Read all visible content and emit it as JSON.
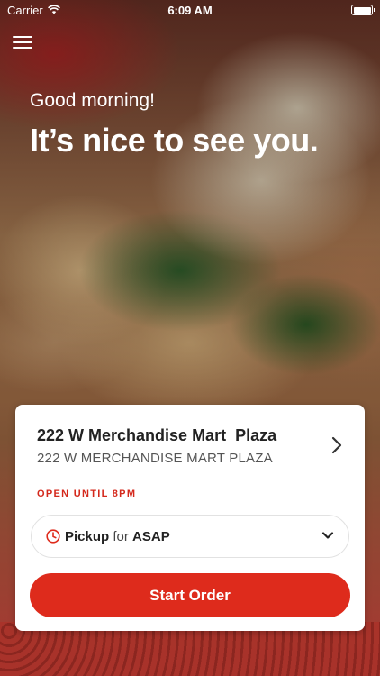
{
  "status_bar": {
    "carrier": "Carrier",
    "time": "6:09 AM"
  },
  "hero": {
    "greeting": "Good morning!",
    "headline": "It’s nice to see you."
  },
  "store_card": {
    "store_name": "222 W Merchandise Mart  Plaza",
    "store_address": "222 W MERCHANDISE MART PLAZA",
    "open_status": "OPEN UNTIL 8PM",
    "pickup": {
      "mode": "Pickup",
      "connector": "for",
      "time": "ASAP"
    },
    "start_order_label": "Start Order"
  },
  "colors": {
    "accent": "#de2b1c",
    "status_red": "#d4291c"
  },
  "icons": {
    "menu": "hamburger-menu-icon",
    "wifi": "wifi-icon",
    "battery": "battery-icon",
    "store_chevron": "chevron-right-icon",
    "clock": "clock-icon",
    "dropdown": "chevron-down-icon"
  }
}
